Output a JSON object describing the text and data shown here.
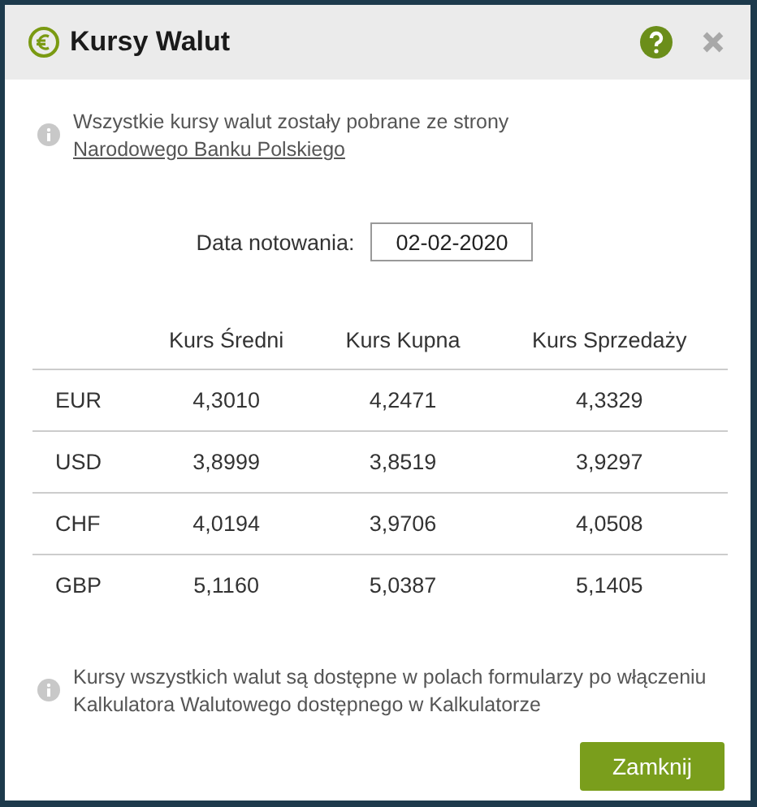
{
  "dialog": {
    "title": "Kursy Walut"
  },
  "info_top": {
    "text": "Wszystkie kursy walut zostały pobrane ze strony ",
    "link": "Narodowego Banku Polskiego"
  },
  "date": {
    "label": "Data notowania:",
    "value": "02-02-2020"
  },
  "table": {
    "columns": [
      "Kurs Średni",
      "Kurs Kupna",
      "Kurs Sprzedaży"
    ],
    "rows": [
      {
        "currency": "EUR",
        "values": [
          "4,3010",
          "4,2471",
          "4,3329"
        ]
      },
      {
        "currency": "USD",
        "values": [
          "3,8999",
          "3,8519",
          "3,9297"
        ]
      },
      {
        "currency": "CHF",
        "values": [
          "4,0194",
          "3,9706",
          "4,0508"
        ]
      },
      {
        "currency": "GBP",
        "values": [
          "5,1160",
          "5,0387",
          "5,1405"
        ]
      }
    ]
  },
  "info_bottom": "Kursy wszystkich walut są dostępne w polach formularzy po włączeniu Kalkulatora Walutowego dostępnego w Kalkulatorze",
  "buttons": [
    "Zamknij"
  ]
}
